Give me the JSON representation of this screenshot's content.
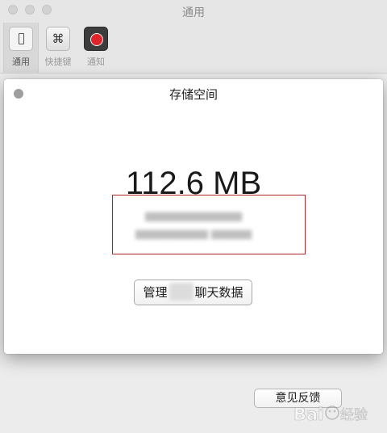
{
  "window": {
    "title": "通用"
  },
  "toolbar": {
    "items": [
      {
        "label": "通用",
        "icon": "general-switch-icon",
        "active": true
      },
      {
        "label": "快捷键",
        "icon": "command-key-icon",
        "glyph": "⌘",
        "active": false
      },
      {
        "label": "通知",
        "icon": "notification-record-icon",
        "active": false
      }
    ]
  },
  "sheet": {
    "title": "存储空间",
    "storage_size": "112.6 MB",
    "manage_button": {
      "prefix": "管理",
      "suffix": "聊天数据"
    }
  },
  "footer": {
    "feedback_label": "意见反馈"
  },
  "watermark": {
    "text": "Baidu 经验"
  },
  "colors": {
    "highlight_box": "#b0242a",
    "record_dot": "#e0242b",
    "window_bg": "#ececec"
  }
}
